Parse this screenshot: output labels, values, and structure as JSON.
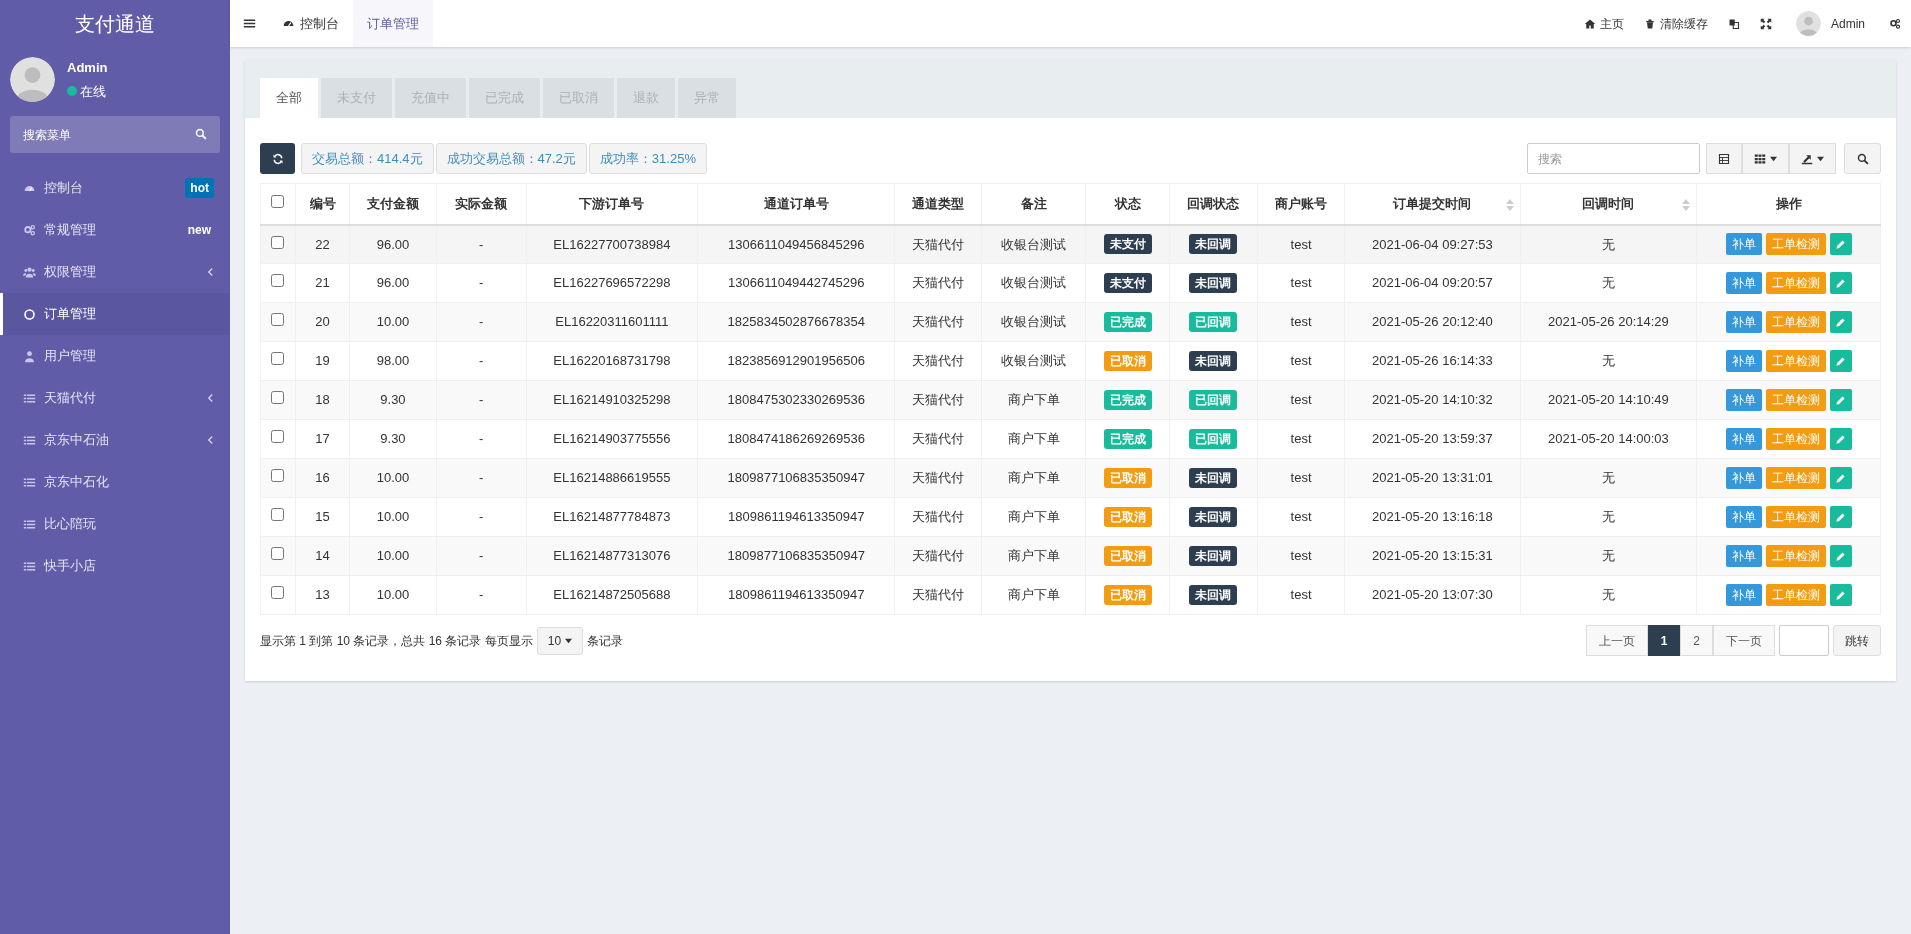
{
  "sidebar": {
    "logo": "支付通道",
    "user": {
      "name": "Admin",
      "status": "在线"
    },
    "search": {
      "placeholder": "搜索菜单"
    },
    "items": [
      {
        "kind": "dashboard",
        "label": "控制台",
        "badge": {
          "text": "hot",
          "kind": "box"
        },
        "expandable": false,
        "selected": false
      },
      {
        "kind": "cogs",
        "label": "常规管理",
        "badge": {
          "text": "new",
          "kind": "plain"
        },
        "expandable": false,
        "selected": false
      },
      {
        "kind": "users",
        "label": "权限管理",
        "expandable": true,
        "selected": false
      },
      {
        "kind": "circle",
        "label": "订单管理",
        "expandable": false,
        "selected": true
      },
      {
        "kind": "user",
        "label": "用户管理",
        "expandable": false,
        "selected": false
      },
      {
        "kind": "list",
        "label": "天猫代付",
        "expandable": true,
        "selected": false
      },
      {
        "kind": "list",
        "label": "京东中石油",
        "expandable": true,
        "selected": false
      },
      {
        "kind": "list",
        "label": "京东中石化",
        "expandable": false,
        "selected": false
      },
      {
        "kind": "list",
        "label": "比心陪玩",
        "expandable": false,
        "selected": false
      },
      {
        "kind": "list",
        "label": "快手小店",
        "expandable": false,
        "selected": false
      }
    ]
  },
  "header": {
    "tabs": [
      {
        "label": "控制台",
        "kind": "dashboard",
        "selected": false
      },
      {
        "label": "订单管理",
        "selected": true
      }
    ],
    "actions": [
      {
        "kind": "home",
        "label": "主页"
      },
      {
        "kind": "trash",
        "label": "清除缓存"
      },
      {
        "kind": "translate"
      },
      {
        "kind": "fullscreen"
      },
      {
        "kind": "avatar",
        "label": "Admin"
      },
      {
        "kind": "cogs"
      }
    ]
  },
  "filter_tabs": [
    {
      "label": "全部",
      "selected": true
    },
    {
      "label": "未支付",
      "selected": false
    },
    {
      "label": "充值中",
      "selected": false
    },
    {
      "label": "已完成",
      "selected": false
    },
    {
      "label": "已取消",
      "selected": false
    },
    {
      "label": "退款",
      "selected": false
    },
    {
      "label": "异常",
      "selected": false
    }
  ],
  "toolbar": {
    "stats": [
      "交易总额：414.4元",
      "成功交易总额：47.2元",
      "成功率：31.25%"
    ],
    "search": {
      "placeholder": "搜索"
    }
  },
  "table": {
    "select_all_checked": false,
    "columns": [
      {
        "label": "编号",
        "sortable": false
      },
      {
        "label": "支付金额",
        "sortable": false
      },
      {
        "label": "实际金额",
        "sortable": false
      },
      {
        "label": "下游订单号",
        "sortable": false
      },
      {
        "label": "通道订单号",
        "sortable": false
      },
      {
        "label": "通道类型",
        "sortable": false
      },
      {
        "label": "备注",
        "sortable": false
      },
      {
        "label": "状态",
        "sortable": false
      },
      {
        "label": "回调状态",
        "sortable": false
      },
      {
        "label": "商户账号",
        "sortable": false
      },
      {
        "label": "订单提交时间",
        "sortable": true
      },
      {
        "label": "回调时间",
        "sortable": true
      },
      {
        "label": "操作",
        "sortable": false
      }
    ],
    "rows": [
      {
        "checked": false,
        "cells": [
          "22",
          "96.00",
          "-",
          "EL16227700738984",
          "1306611049456845296",
          "天猫代付",
          "收银台测试"
        ],
        "status": {
          "text": "未支付",
          "color": "#2c3e50"
        },
        "callback": {
          "text": "未回调",
          "color": "#2c3e50"
        },
        "merchant": "test",
        "submitted": "2021-06-04 09:27:53",
        "callback_time": "无",
        "actions": [
          "补单",
          "工单检测"
        ]
      },
      {
        "checked": false,
        "cells": [
          "21",
          "96.00",
          "-",
          "EL16227696572298",
          "1306611049442745296",
          "天猫代付",
          "收银台测试"
        ],
        "status": {
          "text": "未支付",
          "color": "#2c3e50"
        },
        "callback": {
          "text": "未回调",
          "color": "#2c3e50"
        },
        "merchant": "test",
        "submitted": "2021-06-04 09:20:57",
        "callback_time": "无",
        "actions": [
          "补单",
          "工单检测"
        ]
      },
      {
        "checked": false,
        "cells": [
          "20",
          "10.00",
          "-",
          "EL16220311601111",
          "1825834502876678354",
          "天猫代付",
          "收银台测试"
        ],
        "status": {
          "text": "已完成",
          "color": "#18bc9c"
        },
        "callback": {
          "text": "已回调",
          "color": "#18bc9c"
        },
        "merchant": "test",
        "submitted": "2021-05-26 20:12:40",
        "callback_time": "2021-05-26 20:14:29",
        "actions": [
          "补单",
          "工单检测"
        ]
      },
      {
        "checked": false,
        "cells": [
          "19",
          "98.00",
          "-",
          "EL16220168731798",
          "1823856912901956506",
          "天猫代付",
          "收银台测试"
        ],
        "status": {
          "text": "已取消",
          "color": "#f39c12"
        },
        "callback": {
          "text": "未回调",
          "color": "#2c3e50"
        },
        "merchant": "test",
        "submitted": "2021-05-26 16:14:33",
        "callback_time": "无",
        "actions": [
          "补单",
          "工单检测"
        ]
      },
      {
        "checked": false,
        "cells": [
          "18",
          "9.30",
          "-",
          "EL16214910325298",
          "1808475302330269536",
          "天猫代付",
          "商户下单"
        ],
        "status": {
          "text": "已完成",
          "color": "#18bc9c"
        },
        "callback": {
          "text": "已回调",
          "color": "#18bc9c"
        },
        "merchant": "test",
        "submitted": "2021-05-20 14:10:32",
        "callback_time": "2021-05-20 14:10:49",
        "actions": [
          "补单",
          "工单检测"
        ]
      },
      {
        "checked": false,
        "cells": [
          "17",
          "9.30",
          "-",
          "EL16214903775556",
          "1808474186269269536",
          "天猫代付",
          "商户下单"
        ],
        "status": {
          "text": "已完成",
          "color": "#18bc9c"
        },
        "callback": {
          "text": "已回调",
          "color": "#18bc9c"
        },
        "merchant": "test",
        "submitted": "2021-05-20 13:59:37",
        "callback_time": "2021-05-20 14:00:03",
        "actions": [
          "补单",
          "工单检测"
        ]
      },
      {
        "checked": false,
        "cells": [
          "16",
          "10.00",
          "-",
          "EL16214886619555",
          "1809877106835350947",
          "天猫代付",
          "商户下单"
        ],
        "status": {
          "text": "已取消",
          "color": "#f39c12"
        },
        "callback": {
          "text": "未回调",
          "color": "#2c3e50"
        },
        "merchant": "test",
        "submitted": "2021-05-20 13:31:01",
        "callback_time": "无",
        "actions": [
          "补单",
          "工单检测"
        ]
      },
      {
        "checked": false,
        "cells": [
          "15",
          "10.00",
          "-",
          "EL16214877784873",
          "1809861194613350947",
          "天猫代付",
          "商户下单"
        ],
        "status": {
          "text": "已取消",
          "color": "#f39c12"
        },
        "callback": {
          "text": "未回调",
          "color": "#2c3e50"
        },
        "merchant": "test",
        "submitted": "2021-05-20 13:16:18",
        "callback_time": "无",
        "actions": [
          "补单",
          "工单检测"
        ]
      },
      {
        "checked": false,
        "cells": [
          "14",
          "10.00",
          "-",
          "EL16214877313076",
          "1809877106835350947",
          "天猫代付",
          "商户下单"
        ],
        "status": {
          "text": "已取消",
          "color": "#f39c12"
        },
        "callback": {
          "text": "未回调",
          "color": "#2c3e50"
        },
        "merchant": "test",
        "submitted": "2021-05-20 13:15:31",
        "callback_time": "无",
        "actions": [
          "补单",
          "工单检测"
        ]
      },
      {
        "checked": false,
        "cells": [
          "13",
          "10.00",
          "-",
          "EL16214872505688",
          "1809861194613350947",
          "天猫代付",
          "商户下单"
        ],
        "status": {
          "text": "已取消",
          "color": "#f39c12"
        },
        "callback": {
          "text": "未回调",
          "color": "#2c3e50"
        },
        "merchant": "test",
        "submitted": "2021-05-20 13:07:30",
        "callback_time": "无",
        "actions": [
          "补单",
          "工单检测"
        ]
      }
    ]
  },
  "pagination": {
    "summary": "显示第 1 到第 10 条记录，总共 16 条记录 每页显示",
    "page_size": "10",
    "summary_end": "条记录",
    "pages": [
      {
        "label": "上一页",
        "selected": false
      },
      {
        "label": "1",
        "selected": true
      },
      {
        "label": "2",
        "selected": false
      },
      {
        "label": "下一页",
        "selected": false
      }
    ],
    "jump": "跳转"
  }
}
